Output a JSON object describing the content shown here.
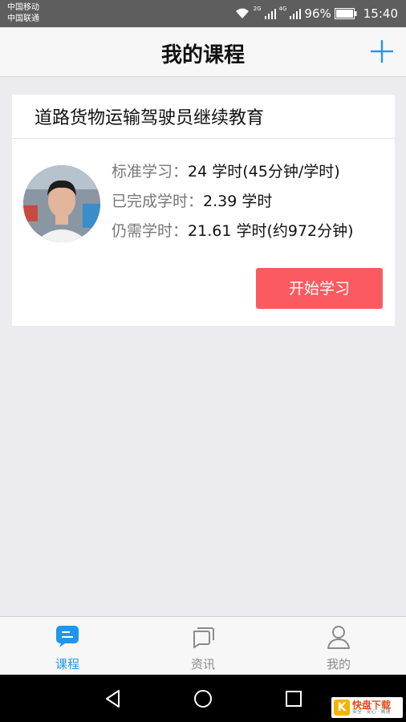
{
  "status_bar": {
    "carrier1": "中国移动",
    "carrier2": "中国联通",
    "net1": "2G",
    "net2": "4G",
    "battery": "96%",
    "time": "15:40"
  },
  "header": {
    "title": "我的课程",
    "add_icon": "plus-icon"
  },
  "course": {
    "title": "道路货物运输驾驶员继续教育",
    "avatar_icon": "user-photo",
    "rows": [
      {
        "label": "标准学习：",
        "value": "24 学时(45分钟/学时)"
      },
      {
        "label": "已完成学时：",
        "value": "2.39 学时"
      },
      {
        "label": "仍需学时：",
        "value": "21.61 学时(约972分钟)"
      }
    ],
    "start_button": "开始学习"
  },
  "tabs": [
    {
      "label": "课程",
      "icon": "course-icon",
      "active": true
    },
    {
      "label": "资讯",
      "icon": "news-icon",
      "active": false
    },
    {
      "label": "我的",
      "icon": "person-icon",
      "active": false
    }
  ],
  "watermark": {
    "brand": "快盘下载",
    "slogan": "安全 · 安心 · 高速"
  },
  "colors": {
    "accent": "#2196e8",
    "start_button": "#fb5a61"
  }
}
